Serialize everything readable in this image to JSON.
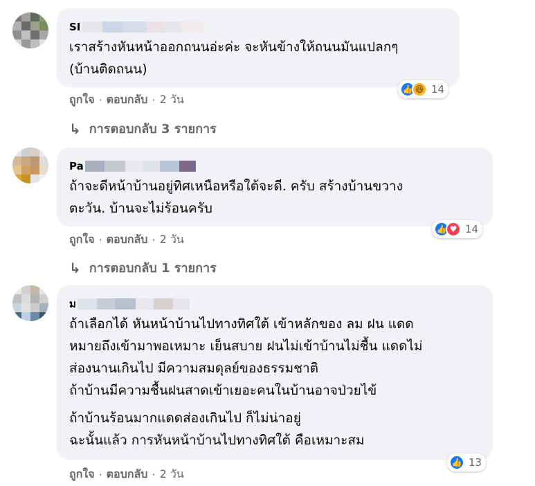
{
  "comments": [
    {
      "author": "SI",
      "lines": [
        "เราสร้างหันหน้าออกถนนอ่ะค่ะ จะหันข้างให้ถนนมันแปลกๆ",
        "(บ้านติดถนน)"
      ],
      "reaction_icons": [
        "like-icon",
        "haha-icon"
      ],
      "reaction_count": "14",
      "actions": {
        "like": "ถูกใจ",
        "reply": "ตอบกลับ",
        "time": "2 วัน"
      },
      "replies": "การตอบกลับ 3 รายการ"
    },
    {
      "author": "Pa",
      "lines": [
        "ถ้าจะดีหน้าบ้านอยู่ทิศเหนือหรือใต้จะดี. ครับ สร้างบ้านขวาง",
        "ตะวัน. บ้านจะไม่ร้อนครับ"
      ],
      "reaction_icons": [
        "like-icon",
        "love-icon"
      ],
      "reaction_count": "14",
      "actions": {
        "like": "ถูกใจ",
        "reply": "ตอบกลับ",
        "time": "2 วัน"
      },
      "replies": "การตอบกลับ 1 รายการ"
    },
    {
      "author": "ม",
      "lines": [
        "ถ้าเลือกได้ หันหน้าบ้านไปทางทิศใต้ เข้าหลักของ ลม ฝน แดด",
        "หมายถึงเข้ามาพอเหมาะ เย็นสบาย ฝนไม่เข้าบ้านไม่ชื้น แดดไม่",
        "ส่องนานเกินไป มีความสมดุลย์ของธรรมชาติ",
        "ถ้าบ้านมีความชื้นฝนสาดเข้าเยอะคนในบ้านอาจป่วยไข้"
      ],
      "lines2": [
        "ถ้าบ้านร้อนมากแดดส่องเกินไป ก็ไม่น่าอยู่",
        "ฉะนั้นแล้ว การหันหน้าบ้านไปทางทิศใต้ คือเหมาะสม"
      ],
      "reaction_icons": [
        "like-icon"
      ],
      "reaction_count": "13",
      "actions": {
        "like": "ถูกใจ",
        "reply": "ตอบกลับ",
        "time": "2 วัน"
      }
    }
  ],
  "colors": {
    "bubble": "#f0f2f5",
    "meta": "#65676b",
    "like": "#1877f2",
    "love": "#f33e58",
    "haha": "#f7b125"
  }
}
